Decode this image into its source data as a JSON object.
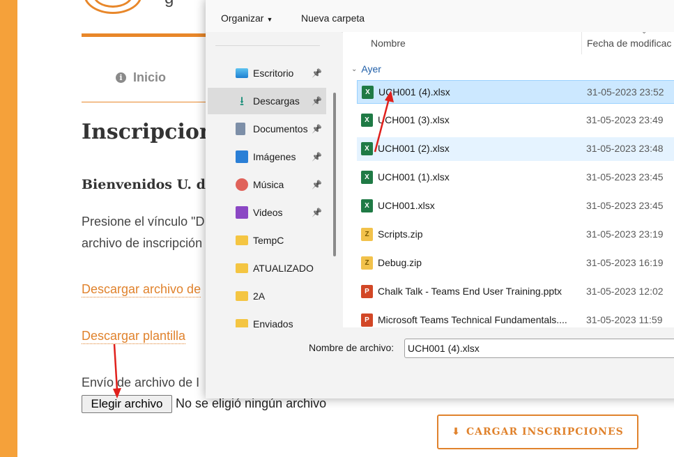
{
  "page": {
    "nav_home": "Inicio",
    "title": "Inscripcione",
    "welcome": "Bienvenidos U. d",
    "instruction_line1": "Presione el vínculo \"D",
    "instruction_line2": "archivo de inscripción",
    "download_link": "Descargar archivo de",
    "template_link": "Descargar plantilla",
    "upload_label": "Envío de archivo de I",
    "choose_file_button": "Elegir archivo",
    "no_file_text": "No se eligió ningún archivo",
    "upload_button": "CARGAR INSCRIPCIONES",
    "logo_fragment": "g"
  },
  "dialog": {
    "toolbar": {
      "organize": "Organizar",
      "new_folder": "Nueva carpeta"
    },
    "nav_items": [
      {
        "label": "Escritorio",
        "icon": "desktop-icon",
        "pinned": true
      },
      {
        "label": "Descargas",
        "icon": "download-icon",
        "pinned": true,
        "selected": true
      },
      {
        "label": "Documentos",
        "icon": "documents-icon",
        "pinned": true
      },
      {
        "label": "Imágenes",
        "icon": "pictures-icon",
        "pinned": true
      },
      {
        "label": "Música",
        "icon": "music-icon",
        "pinned": true
      },
      {
        "label": "Videos",
        "icon": "videos-icon",
        "pinned": true
      },
      {
        "label": "TempC",
        "icon": "folder-icon",
        "pinned": false
      },
      {
        "label": "ATUALIZADO",
        "icon": "folder-icon",
        "pinned": false
      },
      {
        "label": "2A",
        "icon": "folder-icon",
        "pinned": false
      },
      {
        "label": "Enviados",
        "icon": "folder-icon",
        "pinned": false
      }
    ],
    "columns": {
      "name": "Nombre",
      "date": "Fecha de modificac"
    },
    "group_label": "Ayer",
    "files": [
      {
        "name": "UCH001 (4).xlsx",
        "date": "31-05-2023 23:52",
        "type": "excel",
        "state": "selected"
      },
      {
        "name": "UCH001 (3).xlsx",
        "date": "31-05-2023 23:49",
        "type": "excel",
        "state": ""
      },
      {
        "name": "UCH001 (2).xlsx",
        "date": "31-05-2023 23:48",
        "type": "excel",
        "state": "hover"
      },
      {
        "name": "UCH001 (1).xlsx",
        "date": "31-05-2023 23:45",
        "type": "excel",
        "state": ""
      },
      {
        "name": "UCH001.xlsx",
        "date": "31-05-2023 23:45",
        "type": "excel",
        "state": ""
      },
      {
        "name": "Scripts.zip",
        "date": "31-05-2023 23:19",
        "type": "zip",
        "state": ""
      },
      {
        "name": "Debug.zip",
        "date": "31-05-2023 16:19",
        "type": "zip",
        "state": ""
      },
      {
        "name": "Chalk Talk - Teams End User Training.pptx",
        "date": "31-05-2023 12:02",
        "type": "powerpoint",
        "state": ""
      },
      {
        "name": "Microsoft Teams Technical Fundamentals....",
        "date": "31-05-2023 11:59",
        "type": "powerpoint",
        "state": ""
      }
    ],
    "filename_label": "Nombre de archivo:",
    "filename_value": "UCH001 (4).xlsx"
  },
  "colors": {
    "accent": "#e0822c",
    "selection": "#cce8ff",
    "annotation_arrow": "#e0201c"
  }
}
